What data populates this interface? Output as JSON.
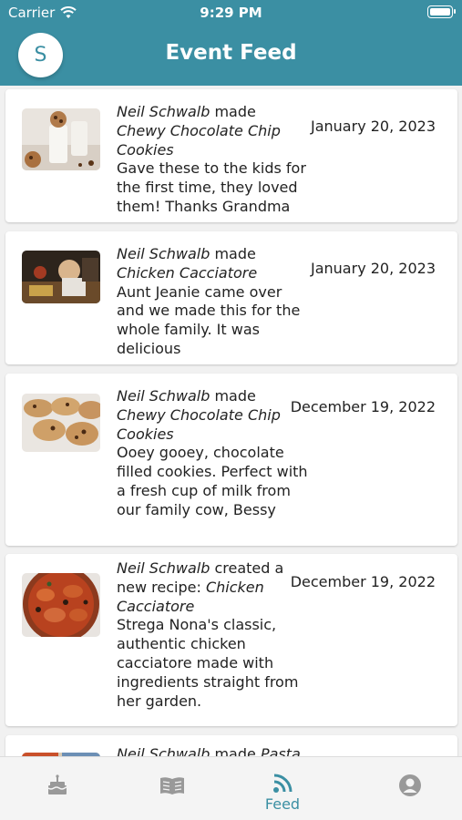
{
  "status_bar": {
    "carrier": "Carrier",
    "time": "9:29 PM"
  },
  "header": {
    "title": "Event Feed",
    "avatar_initial": "S"
  },
  "feed": {
    "items": [
      {
        "user": "Neil Schwalb",
        "action": " made",
        "recipe": "Chewy Chocolate Chip Cookies",
        "description": "Gave these to the kids for the first time, they loved them! Thanks Grandma",
        "date": "January 20, 2023"
      },
      {
        "user": "Neil Schwalb",
        "action": " made",
        "recipe": "Chicken Cacciatore",
        "description": "Aunt Jeanie came over and we made this for the whole family. It was delicious",
        "date": "January 20, 2023"
      },
      {
        "user": "Neil Schwalb",
        "action": " made",
        "recipe": "Chewy Chocolate Chip Cookies",
        "description": "Ooey gooey, chocolate filled cookies. Perfect with a fresh cup of milk from our family cow, Bessy",
        "date": "December 19, 2022"
      },
      {
        "user": "Neil Schwalb",
        "action": " created a new recipe: ",
        "recipe": "Chicken Cacciatore",
        "description": "Strega Nona's classic, authentic chicken cacciatore made with ingredients straight from her garden.",
        "date": "December 19, 2022"
      },
      {
        "user": "Neil Schwalb",
        "action": " made ",
        "recipe": "Pasta"
      }
    ]
  },
  "tabbar": {
    "tabs": [
      {
        "icon": "cake-icon"
      },
      {
        "icon": "book-icon"
      },
      {
        "icon": "feed-icon",
        "label": "Feed",
        "active": true
      },
      {
        "icon": "profile-icon"
      }
    ]
  },
  "colors": {
    "accent": "#3b8fa3",
    "header": "#3b8fa3",
    "background": "#f1f1f1"
  }
}
